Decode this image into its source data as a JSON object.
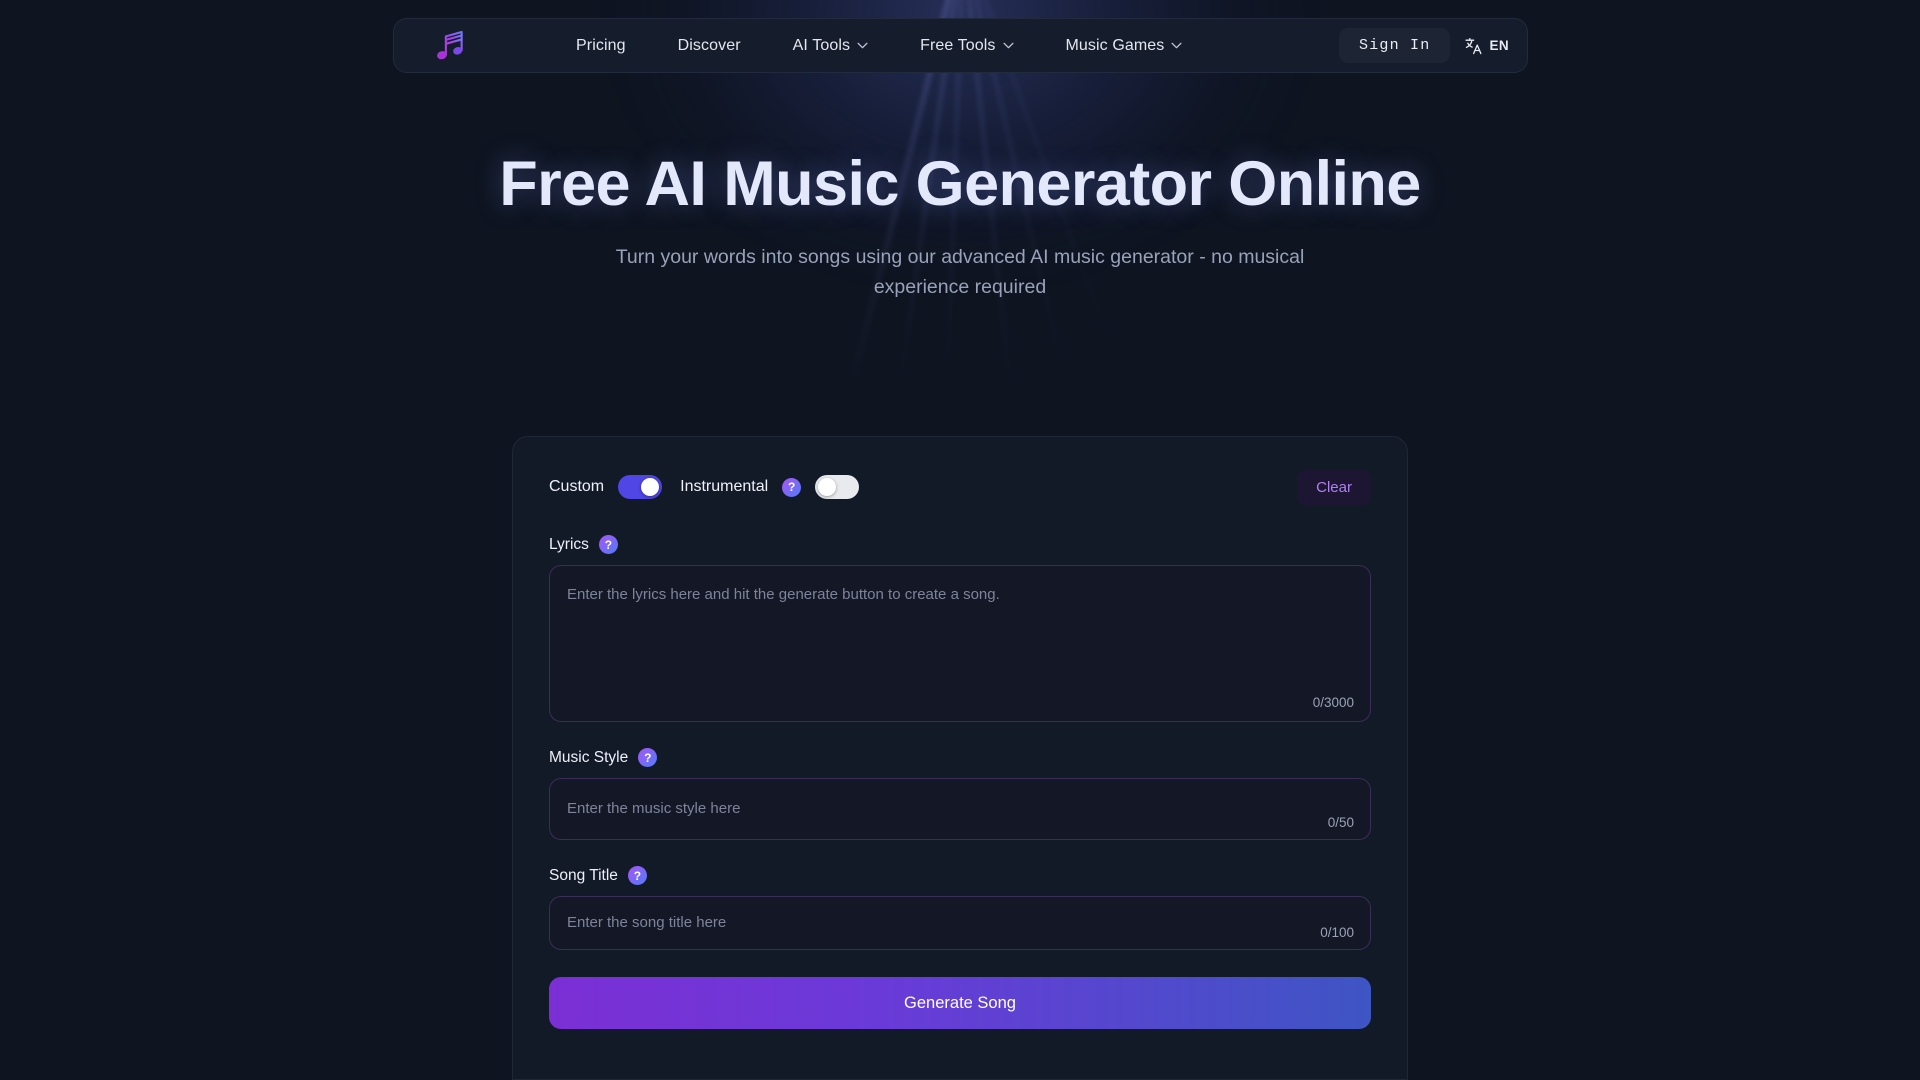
{
  "nav": {
    "logo_icon": "music-note-icon",
    "links": [
      {
        "label": "Pricing",
        "has_chevron": false
      },
      {
        "label": "Discover",
        "has_chevron": false
      },
      {
        "label": "AI Tools",
        "has_chevron": true
      },
      {
        "label": "Free Tools",
        "has_chevron": true
      },
      {
        "label": "Music Games",
        "has_chevron": true
      }
    ],
    "sign_in": "Sign In",
    "language": "EN",
    "language_icon": "translate-icon"
  },
  "hero": {
    "title": "Free AI Music Generator Online",
    "subtitle": "Turn your words into songs using our advanced AI music generator - no musical experience required"
  },
  "generator": {
    "custom_label": "Custom",
    "custom_enabled": true,
    "instrumental_label": "Instrumental",
    "instrumental_enabled": false,
    "help_glyph": "?",
    "clear_label": "Clear",
    "lyrics": {
      "label": "Lyrics",
      "placeholder": "Enter the lyrics here and hit the generate button to create a song.",
      "value": "",
      "counter": "0/3000"
    },
    "music_style": {
      "label": "Music Style",
      "placeholder": "Enter the music style here",
      "value": "",
      "counter": "0/50"
    },
    "song_title": {
      "label": "Song Title",
      "placeholder": "Enter the song title here",
      "value": "",
      "counter": "0/100"
    },
    "generate_label": "Generate Song"
  },
  "colors": {
    "page_bg": "#0e1420",
    "nav_bg": "#151c2b",
    "card_bg": "#121927",
    "accent_purple": "#7b2fd4",
    "accent_blue": "#3e55c4",
    "toggle_on": "#4f46e5",
    "clear_text": "#b07ef5",
    "field_border": "#3a2d57"
  }
}
